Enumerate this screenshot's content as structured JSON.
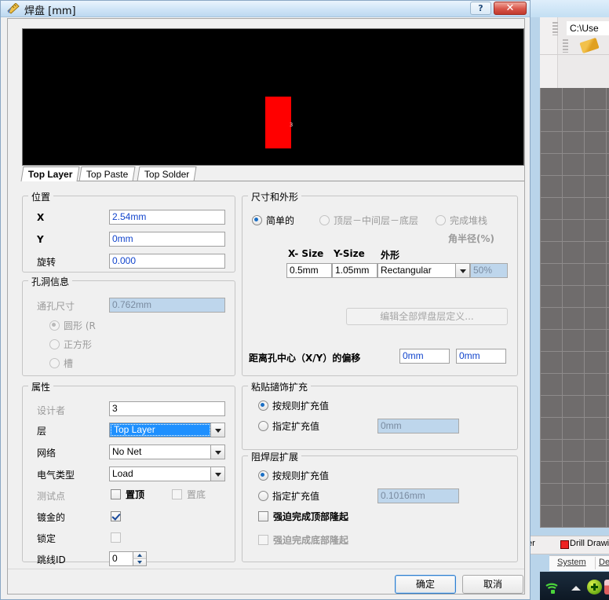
{
  "window": {
    "title": "焊盘 [mm]",
    "icon": "ruler-icon",
    "help_label": "?",
    "close_label": "✕"
  },
  "preview": {
    "designator_text": "3",
    "pad_color": "#ff0000",
    "background_color": "#000000"
  },
  "tabs": [
    {
      "label": "Top Layer",
      "active": true
    },
    {
      "label": "Top Paste",
      "active": false
    },
    {
      "label": "Top Solder",
      "active": false
    }
  ],
  "position": {
    "legend": "位置",
    "fields": [
      {
        "label": "X",
        "value": "2.54mm"
      },
      {
        "label": "Y",
        "value": "0mm"
      },
      {
        "label": "旋转",
        "value": "0.000"
      }
    ]
  },
  "hole": {
    "legend": "孔洞信息",
    "size_label": "通孔尺寸",
    "size_value": "0.762mm",
    "options": [
      {
        "label": "圆形 (R",
        "selected": true
      },
      {
        "label": "正方形",
        "selected": false
      },
      {
        "label": "槽",
        "selected": false
      }
    ]
  },
  "attributes": {
    "legend": "属性",
    "designator_label": "设计者",
    "designator_value": "3",
    "layer_label": "层",
    "layer_value": "Top Layer",
    "net_label": "网络",
    "net_value": "No Net",
    "electrical_label": "电气类型",
    "electrical_value": "Load",
    "testpoint_label": "测试点",
    "testpoint_top_label": "置顶",
    "testpoint_top_checked": false,
    "testpoint_bottom_label": "置底",
    "testpoint_bottom_checked": false,
    "plated_label": "镀金的",
    "plated_checked": true,
    "locked_label": "锁定",
    "locked_checked": false,
    "jumper_label": "跳线ID",
    "jumper_value": "0"
  },
  "size_shape": {
    "legend": "尺寸和外形",
    "mode_simple": "简单的",
    "mode_toplayer": "顶层－中间层－底层",
    "mode_fullstack": "完成堆栈",
    "col_xsize": "X- Size",
    "col_ysize": "Y-Size",
    "col_shape": "外形",
    "col_corner": "角半径(%)",
    "xsize_value": "0.5mm",
    "ysize_value": "1.05mm",
    "shape_value": "Rectangular",
    "corner_value": "50%",
    "edit_all_button": "编辑全部焊盘层定义...",
    "offset_label": "距离孔中心（X/Y）的偏移",
    "offset_x": "0mm",
    "offset_y": "0mm"
  },
  "paste_mask": {
    "legend": "粘贴擿饰扩充",
    "rule_option": "按规则扩充值",
    "rule_selected": true,
    "specify_option": "指定扩充值",
    "specify_value": "0mm"
  },
  "solder_mask": {
    "legend": "阻焊层扩展",
    "rule_option": "按规则扩充值",
    "rule_selected": true,
    "specify_option": "指定扩充值",
    "specify_value": "0.1016mm",
    "force_top_label": "强迫完成顶部隆起",
    "force_top_checked": false,
    "force_bottom_label": "强迫完成底部隆起",
    "force_bottom_checked": false
  },
  "footer": {
    "ok_label": "确定",
    "cancel_label": "取消"
  },
  "background": {
    "path_text": "C:\\Use",
    "tab_partial": "er",
    "tab_drill": "Drill Drawing",
    "panel_system": "System",
    "panel_design": "De"
  }
}
